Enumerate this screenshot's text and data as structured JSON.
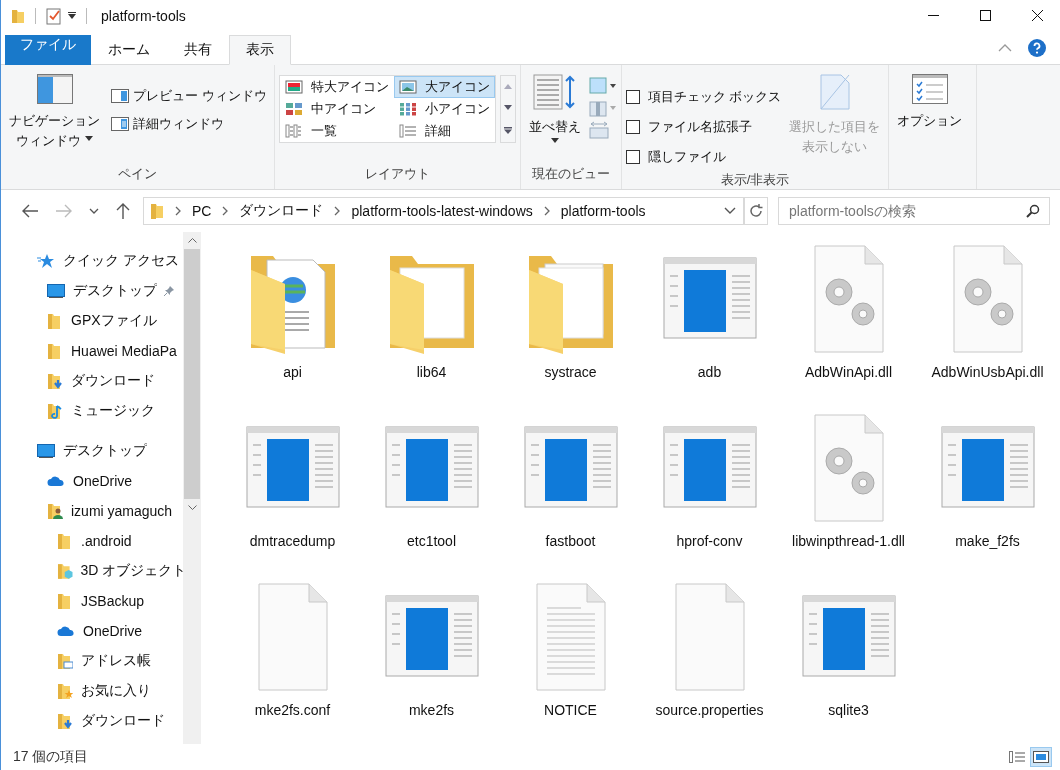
{
  "window": {
    "title": "platform-tools"
  },
  "tabs": [
    {
      "label": "ファイル",
      "kind": "file",
      "selected": false
    },
    {
      "label": "ホーム",
      "kind": "tab",
      "selected": false
    },
    {
      "label": "共有",
      "kind": "tab",
      "selected": false
    },
    {
      "label": "表示",
      "kind": "tab",
      "selected": true
    }
  ],
  "ribbon": {
    "pane": {
      "nav_button": [
        "ナビゲーション",
        "ウィンドウ"
      ],
      "preview": "プレビュー ウィンドウ",
      "details": "詳細ウィンドウ",
      "label": "ペイン"
    },
    "layout": {
      "items": [
        {
          "label": "特大アイコン",
          "kind": "xl",
          "selected": false
        },
        {
          "label": "大アイコン",
          "kind": "large",
          "selected": true
        },
        {
          "label": "中アイコン",
          "kind": "medium",
          "selected": false
        },
        {
          "label": "小アイコン",
          "kind": "small",
          "selected": false
        },
        {
          "label": "一覧",
          "kind": "list",
          "selected": false
        },
        {
          "label": "詳細",
          "kind": "details",
          "selected": false
        }
      ],
      "label": "レイアウト"
    },
    "current_view": {
      "sort": "並べ替え",
      "label": "現在のビュー"
    },
    "show_hide": {
      "checkboxes": [
        {
          "label": "項目チェック ボックス",
          "checked": false
        },
        {
          "label": "ファイル名拡張子",
          "checked": false
        },
        {
          "label": "隠しファイル",
          "checked": false
        }
      ],
      "hide_selected": {
        "lines": [
          "選択した項目を",
          "表示しない"
        ],
        "disabled": true
      },
      "label": "表示/非表示"
    },
    "options": {
      "label": "オプション"
    }
  },
  "address": {
    "crumbs": [
      "PC",
      "ダウンロード",
      "platform-tools-latest-windows",
      "platform-tools"
    ],
    "search_placeholder": "platform-toolsの検索"
  },
  "nav": [
    {
      "label": "クイック アクセス",
      "kind": "quick",
      "children": [
        {
          "label": "デスクトップ",
          "kind": "desktop",
          "pinned": true
        },
        {
          "label": "GPXファイル",
          "kind": "folder"
        },
        {
          "label": "Huawei MediaPa",
          "kind": "folder"
        },
        {
          "label": "ダウンロード",
          "kind": "download"
        },
        {
          "label": "ミュージック",
          "kind": "music"
        }
      ]
    },
    {
      "label": "デスクトップ",
      "kind": "desktop",
      "children": [
        {
          "label": "OneDrive",
          "kind": "onedrive"
        },
        {
          "label": "izumi yamaguch",
          "kind": "user",
          "children": [
            {
              "label": ".android",
              "kind": "folder"
            },
            {
              "label": "3D オブジェクト",
              "kind": "cube"
            },
            {
              "label": "JSBackup",
              "kind": "folder"
            },
            {
              "label": "OneDrive",
              "kind": "onedrive"
            },
            {
              "label": "アドレス帳",
              "kind": "contacts"
            },
            {
              "label": "お気に入り",
              "kind": "favorites"
            },
            {
              "label": "ダウンロード",
              "kind": "download"
            }
          ]
        }
      ]
    }
  ],
  "files": [
    {
      "name": "api",
      "kind": "folder-doc"
    },
    {
      "name": "lib64",
      "kind": "folder"
    },
    {
      "name": "systrace",
      "kind": "folder-files"
    },
    {
      "name": "adb",
      "kind": "exe"
    },
    {
      "name": "AdbWinApi.dll",
      "kind": "dll"
    },
    {
      "name": "AdbWinUsbApi.dll",
      "kind": "dll"
    },
    {
      "name": "dmtracedump",
      "kind": "exe"
    },
    {
      "name": "etc1tool",
      "kind": "exe"
    },
    {
      "name": "fastboot",
      "kind": "exe"
    },
    {
      "name": "hprof-conv",
      "kind": "exe"
    },
    {
      "name": "libwinpthread-1.dll",
      "kind": "dll"
    },
    {
      "name": "make_f2fs",
      "kind": "exe"
    },
    {
      "name": "mke2fs.conf",
      "kind": "doc"
    },
    {
      "name": "mke2fs",
      "kind": "exe"
    },
    {
      "name": "NOTICE",
      "kind": "text"
    },
    {
      "name": "source.properties",
      "kind": "doc"
    },
    {
      "name": "sqlite3",
      "kind": "exe"
    }
  ],
  "status_bar": {
    "count": "17 個の項目",
    "views": [
      {
        "kind": "details",
        "selected": false
      },
      {
        "kind": "large",
        "selected": true
      }
    ]
  }
}
